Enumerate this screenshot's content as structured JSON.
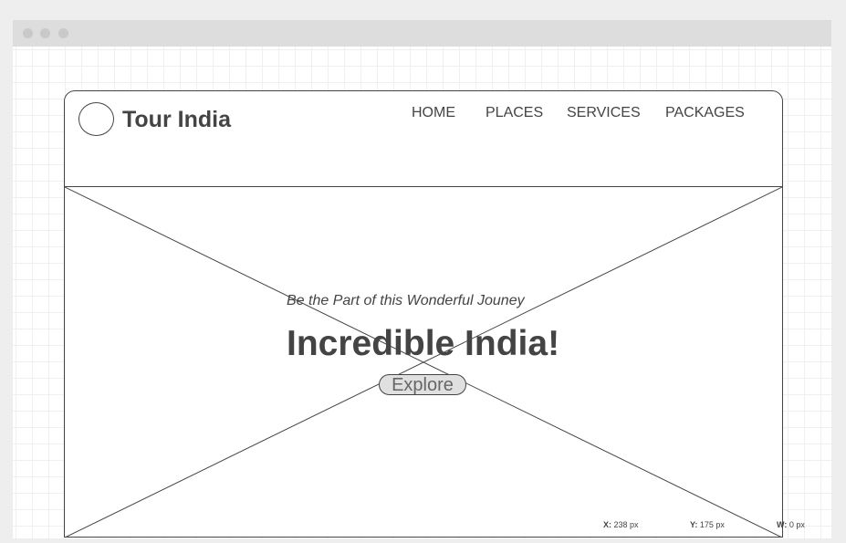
{
  "window": {
    "title_dots": [
      "close-dot",
      "minimize-dot",
      "maximize-dot"
    ]
  },
  "header": {
    "brand": "Tour India",
    "nav": [
      {
        "label": "HOME"
      },
      {
        "label": "PLACES"
      },
      {
        "label": "SERVICES"
      },
      {
        "label": "PACKAGES"
      }
    ]
  },
  "hero": {
    "tagline": "Be the Part of this Wonderful Jouney",
    "headline": "Incredible India!",
    "button_label": "Explore"
  },
  "status": {
    "x_label": "X:",
    "x_value": "238 px",
    "y_label": "Y:",
    "y_value": "175 px",
    "w_label": "W:",
    "w_value": "0 px"
  },
  "colors": {
    "stroke": "#444444",
    "titlebar": "#dddddd",
    "button_fill": "#e0e0e0"
  }
}
